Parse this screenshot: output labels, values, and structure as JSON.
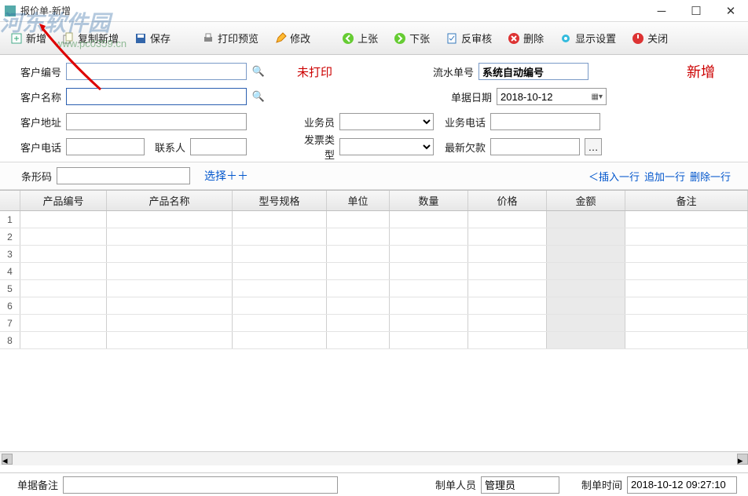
{
  "window": {
    "title": "报价单-新增"
  },
  "watermark": {
    "text": "河东软件园",
    "sub": "www.pc0359.cn"
  },
  "toolbar": {
    "new": "新增",
    "copynew": "复制新增",
    "save": "保存",
    "preview": "打印预览",
    "edit": "修改",
    "prev": "上张",
    "next": "下张",
    "unaudit": "反审核",
    "delete": "删除",
    "display": "显示设置",
    "close": "关闭"
  },
  "form": {
    "custCodeLbl": "客户编号",
    "custCode": "",
    "custNameLbl": "客户名称",
    "custName": "",
    "custAddrLbl": "客户地址",
    "custAddr": "",
    "custTelLbl": "客户电话",
    "custTel": "",
    "contactLbl": "联系人",
    "contact": "",
    "salesmanLbl": "业务员",
    "salesman": "",
    "invoiceTypeLbl": "发票类型",
    "invoiceType": "",
    "serialLbl": "流水单号",
    "serial": "系统自动编号",
    "billDateLbl": "单据日期",
    "billDate": "2018-10-12",
    "bizTelLbl": "业务电话",
    "bizTel": "",
    "lastDebtLbl": "最新欠款",
    "lastDebt": "",
    "printStatus": "未打印",
    "mode": "新增"
  },
  "barcode": {
    "lbl": "条形码",
    "value": "",
    "choose": "选择＋＋",
    "insertRow": "＜插入一行",
    "appendRow": "追加一行",
    "deleteRow": "删除一行"
  },
  "grid": {
    "headers": {
      "code": "产品编号",
      "name": "产品名称",
      "spec": "型号规格",
      "unit": "单位",
      "qty": "数量",
      "price": "价格",
      "amount": "金额",
      "remark": "备注"
    },
    "rowNums": [
      "1",
      "2",
      "3",
      "4",
      "5",
      "6",
      "7",
      "8"
    ]
  },
  "footer": {
    "remarkLbl": "单据备注",
    "remark": "",
    "makerLbl": "制单人员",
    "maker": "管理员",
    "makeTimeLbl": "制单时间",
    "makeTime": "2018-10-12 09:27:10"
  },
  "colors": {
    "red": "#cc0000",
    "link": "#0055cc"
  }
}
